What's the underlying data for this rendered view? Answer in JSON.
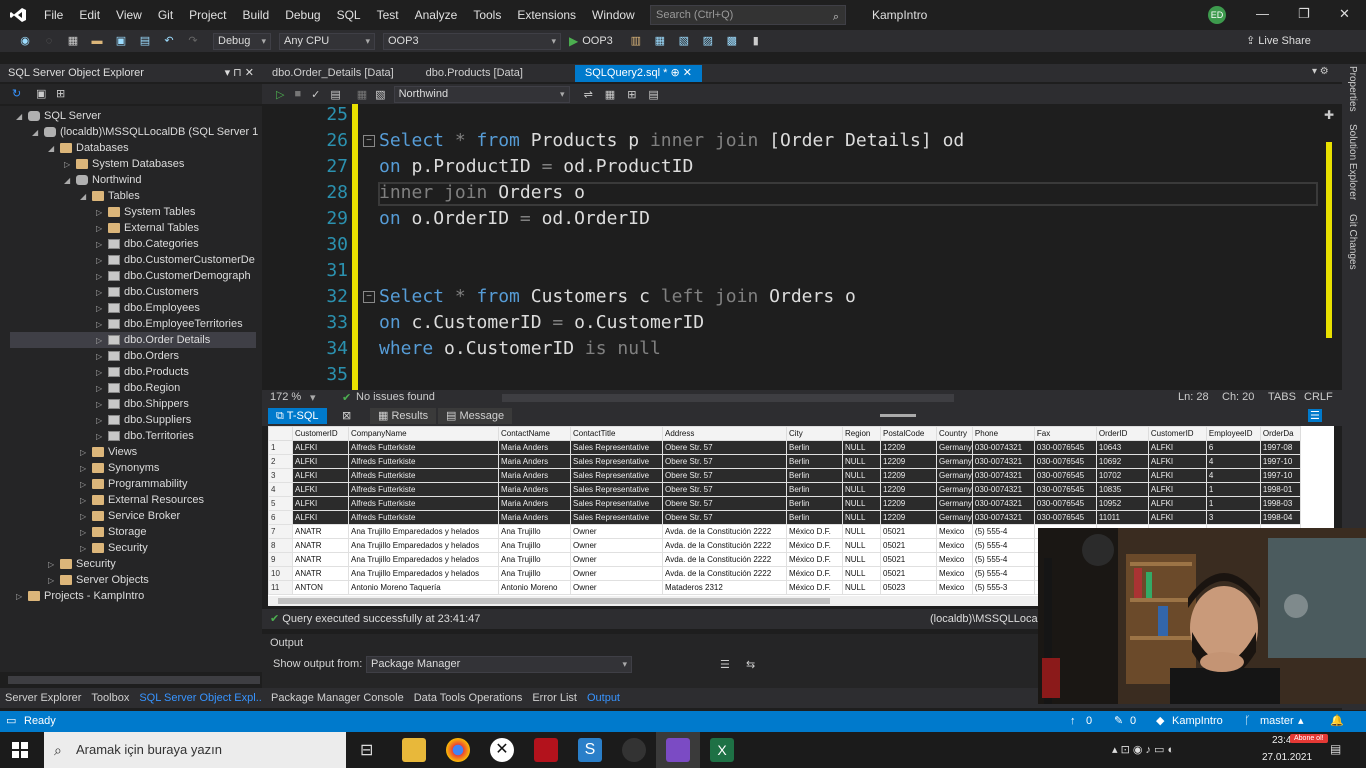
{
  "menu": {
    "items": [
      "File",
      "Edit",
      "View",
      "Git",
      "Project",
      "Build",
      "Debug",
      "SQL",
      "Test",
      "Analyze",
      "Tools",
      "Extensions",
      "Window",
      "Help"
    ],
    "search_placeholder": "Search (Ctrl+Q)",
    "solution": "KampIntro",
    "avatar": "ED"
  },
  "toolbar": {
    "config": "Debug",
    "platform": "Any CPU",
    "project": "OOP3",
    "run_target": "OOP3",
    "live_share": "Live Share"
  },
  "soe": {
    "title": "SQL Server Object Explorer",
    "tree": [
      {
        "label": "SQL Server",
        "level": 0,
        "exp": "◢",
        "icon": "db-ic"
      },
      {
        "label": "(localdb)\\MSSQLLocalDB (SQL Server 1",
        "level": 1,
        "exp": "◢",
        "icon": "db-ic"
      },
      {
        "label": "Databases",
        "level": 2,
        "exp": "◢",
        "icon": "folder"
      },
      {
        "label": "System Databases",
        "level": 3,
        "exp": "▷",
        "icon": "folder"
      },
      {
        "label": "Northwind",
        "level": 3,
        "exp": "◢",
        "icon": "db-ic"
      },
      {
        "label": "Tables",
        "level": 4,
        "exp": "◢",
        "icon": "folder"
      },
      {
        "label": "System Tables",
        "level": 5,
        "exp": "▷",
        "icon": "folder"
      },
      {
        "label": "External Tables",
        "level": 5,
        "exp": "▷",
        "icon": "folder"
      },
      {
        "label": "dbo.Categories",
        "level": 5,
        "exp": "▷",
        "icon": "table-ic"
      },
      {
        "label": "dbo.CustomerCustomerDe",
        "level": 5,
        "exp": "▷",
        "icon": "table-ic"
      },
      {
        "label": "dbo.CustomerDemograph",
        "level": 5,
        "exp": "▷",
        "icon": "table-ic"
      },
      {
        "label": "dbo.Customers",
        "level": 5,
        "exp": "▷",
        "icon": "table-ic"
      },
      {
        "label": "dbo.Employees",
        "level": 5,
        "exp": "▷",
        "icon": "table-ic"
      },
      {
        "label": "dbo.EmployeeTerritories",
        "level": 5,
        "exp": "▷",
        "icon": "table-ic"
      },
      {
        "label": "dbo.Order Details",
        "level": 5,
        "exp": "▷",
        "icon": "table-ic",
        "selected": true
      },
      {
        "label": "dbo.Orders",
        "level": 5,
        "exp": "▷",
        "icon": "table-ic"
      },
      {
        "label": "dbo.Products",
        "level": 5,
        "exp": "▷",
        "icon": "table-ic"
      },
      {
        "label": "dbo.Region",
        "level": 5,
        "exp": "▷",
        "icon": "table-ic"
      },
      {
        "label": "dbo.Shippers",
        "level": 5,
        "exp": "▷",
        "icon": "table-ic"
      },
      {
        "label": "dbo.Suppliers",
        "level": 5,
        "exp": "▷",
        "icon": "table-ic"
      },
      {
        "label": "dbo.Territories",
        "level": 5,
        "exp": "▷",
        "icon": "table-ic"
      },
      {
        "label": "Views",
        "level": 4,
        "exp": "▷",
        "icon": "folder"
      },
      {
        "label": "Synonyms",
        "level": 4,
        "exp": "▷",
        "icon": "folder"
      },
      {
        "label": "Programmability",
        "level": 4,
        "exp": "▷",
        "icon": "folder"
      },
      {
        "label": "External Resources",
        "level": 4,
        "exp": "▷",
        "icon": "folder"
      },
      {
        "label": "Service Broker",
        "level": 4,
        "exp": "▷",
        "icon": "folder"
      },
      {
        "label": "Storage",
        "level": 4,
        "exp": "▷",
        "icon": "folder"
      },
      {
        "label": "Security",
        "level": 4,
        "exp": "▷",
        "icon": "folder"
      },
      {
        "label": "Security",
        "level": 2,
        "exp": "▷",
        "icon": "folder"
      },
      {
        "label": "Server Objects",
        "level": 2,
        "exp": "▷",
        "icon": "folder"
      },
      {
        "label": "Projects - KampIntro",
        "level": 0,
        "exp": "▷",
        "icon": "folder"
      }
    ],
    "bottom_tabs": [
      "Server Explorer",
      "Toolbox",
      "SQL Server Object Expl..."
    ]
  },
  "doc_tabs": [
    "dbo.Order_Details [Data]",
    "dbo.Products [Data]",
    "SQLQuery2.sql *"
  ],
  "query_toolbar": {
    "database": "Northwind"
  },
  "editor": {
    "lines": [
      {
        "n": "25",
        "parts": []
      },
      {
        "n": "26",
        "fold": true,
        "parts": [
          [
            "kw",
            "Select "
          ],
          [
            "gr",
            "* "
          ],
          [
            "kw",
            "from "
          ],
          [
            "",
            "Products p "
          ],
          [
            "gr",
            "inner join "
          ],
          [
            "",
            "[Order Details] od"
          ]
        ]
      },
      {
        "n": "27",
        "parts": [
          [
            "kw",
            "on "
          ],
          [
            "",
            "p.ProductID "
          ],
          [
            "gr",
            "= "
          ],
          [
            "",
            "od.ProductID"
          ]
        ]
      },
      {
        "n": "28",
        "parts": [
          [
            "gr",
            "inner join "
          ],
          [
            "",
            "Orders o"
          ]
        ]
      },
      {
        "n": "29",
        "parts": [
          [
            "kw",
            "on "
          ],
          [
            "",
            "o.OrderID "
          ],
          [
            "gr",
            "= "
          ],
          [
            "",
            "od.OrderID"
          ]
        ]
      },
      {
        "n": "30",
        "parts": []
      },
      {
        "n": "31",
        "parts": []
      },
      {
        "n": "32",
        "fold": true,
        "parts": [
          [
            "kw",
            "Select "
          ],
          [
            "gr",
            "* "
          ],
          [
            "kw",
            "from "
          ],
          [
            "",
            "Customers c "
          ],
          [
            "gr",
            "left join "
          ],
          [
            "",
            "Orders o"
          ]
        ]
      },
      {
        "n": "33",
        "parts": [
          [
            "kw",
            "on "
          ],
          [
            "",
            "c.CustomerID "
          ],
          [
            "gr",
            "= "
          ],
          [
            "",
            "o.CustomerID"
          ]
        ]
      },
      {
        "n": "34",
        "parts": [
          [
            "kw",
            "where "
          ],
          [
            "",
            "o.CustomerID "
          ],
          [
            "gr",
            "is null"
          ]
        ]
      },
      {
        "n": "35",
        "parts": []
      }
    ],
    "zoom": "172 %",
    "issues": "No issues found",
    "ln": "Ln: 28",
    "ch": "Ch: 20",
    "tabs": "TABS",
    "crlf": "CRLF"
  },
  "results": {
    "tabs": [
      "T-SQL",
      "Results",
      "Message"
    ],
    "columns": [
      "",
      "CustomerID",
      "CompanyName",
      "ContactName",
      "ContactTitle",
      "Address",
      "City",
      "Region",
      "PostalCode",
      "Country",
      "Phone",
      "Fax",
      "OrderID",
      "CustomerID",
      "EmployeeID",
      "OrderDa"
    ],
    "rows": [
      [
        "1",
        "ALFKI",
        "Alfreds Futterkiste",
        "Maria Anders",
        "Sales Representative",
        "Obere Str. 57",
        "Berlin",
        "NULL",
        "12209",
        "Germany",
        "030-0074321",
        "030-0076545",
        "10643",
        "ALFKI",
        "6",
        "1997-08"
      ],
      [
        "2",
        "ALFKI",
        "Alfreds Futterkiste",
        "Maria Anders",
        "Sales Representative",
        "Obere Str. 57",
        "Berlin",
        "NULL",
        "12209",
        "Germany",
        "030-0074321",
        "030-0076545",
        "10692",
        "ALFKI",
        "4",
        "1997-10"
      ],
      [
        "3",
        "ALFKI",
        "Alfreds Futterkiste",
        "Maria Anders",
        "Sales Representative",
        "Obere Str. 57",
        "Berlin",
        "NULL",
        "12209",
        "Germany",
        "030-0074321",
        "030-0076545",
        "10702",
        "ALFKI",
        "4",
        "1997-10"
      ],
      [
        "4",
        "ALFKI",
        "Alfreds Futterkiste",
        "Maria Anders",
        "Sales Representative",
        "Obere Str. 57",
        "Berlin",
        "NULL",
        "12209",
        "Germany",
        "030-0074321",
        "030-0076545",
        "10835",
        "ALFKI",
        "1",
        "1998-01"
      ],
      [
        "5",
        "ALFKI",
        "Alfreds Futterkiste",
        "Maria Anders",
        "Sales Representative",
        "Obere Str. 57",
        "Berlin",
        "NULL",
        "12209",
        "Germany",
        "030-0074321",
        "030-0076545",
        "10952",
        "ALFKI",
        "1",
        "1998-03"
      ],
      [
        "6",
        "ALFKI",
        "Alfreds Futterkiste",
        "Maria Anders",
        "Sales Representative",
        "Obere Str. 57",
        "Berlin",
        "NULL",
        "12209",
        "Germany",
        "030-0074321",
        "030-0076545",
        "11011",
        "ALFKI",
        "3",
        "1998-04"
      ],
      [
        "7",
        "ANATR",
        "Ana Trujillo Emparedados y helados",
        "Ana Trujillo",
        "Owner",
        "Avda. de la Constitución 2222",
        "México D.F.",
        "NULL",
        "05021",
        "Mexico",
        "(5) 555-4",
        "",
        "",
        "",
        "",
        ""
      ],
      [
        "8",
        "ANATR",
        "Ana Trujillo Emparedados y helados",
        "Ana Trujillo",
        "Owner",
        "Avda. de la Constitución 2222",
        "México D.F.",
        "NULL",
        "05021",
        "Mexico",
        "(5) 555-4",
        "",
        "",
        "",
        "",
        ""
      ],
      [
        "9",
        "ANATR",
        "Ana Trujillo Emparedados y helados",
        "Ana Trujillo",
        "Owner",
        "Avda. de la Constitución 2222",
        "México D.F.",
        "NULL",
        "05021",
        "Mexico",
        "(5) 555-4",
        "",
        "",
        "",
        "",
        ""
      ],
      [
        "10",
        "ANATR",
        "Ana Trujillo Emparedados y helados",
        "Ana Trujillo",
        "Owner",
        "Avda. de la Constitución 2222",
        "México D.F.",
        "NULL",
        "05021",
        "Mexico",
        "(5) 555-4",
        "",
        "",
        "",
        "",
        ""
      ],
      [
        "11",
        "ANTON",
        "Antonio Moreno Taquería",
        "Antonio Moreno",
        "Owner",
        "Mataderos 2312",
        "México D.F.",
        "NULL",
        "05023",
        "Mexico",
        "(5) 555-3",
        "",
        "",
        "",
        "",
        ""
      ]
    ],
    "status": "Query executed successfully at 23:41:47",
    "connection": "(localdb)\\MSSQLLocal"
  },
  "output": {
    "title": "Output",
    "show_from_label": "Show output from:",
    "source": "Package Manager",
    "tabs": [
      "Package Manager Console",
      "Data Tools Operations",
      "Error List",
      "Output"
    ]
  },
  "side_tabs": [
    "Properties",
    "Solution Explorer",
    "Git Changes"
  ],
  "status": {
    "ready": "Ready",
    "up": "0",
    "pencil": "0",
    "repo": "KampIntro",
    "branch": "master"
  },
  "taskbar": {
    "search_placeholder": "Aramak için buraya yazın",
    "time": "23:4",
    "date": "27.01.2021",
    "badge": "Abone ol!"
  }
}
